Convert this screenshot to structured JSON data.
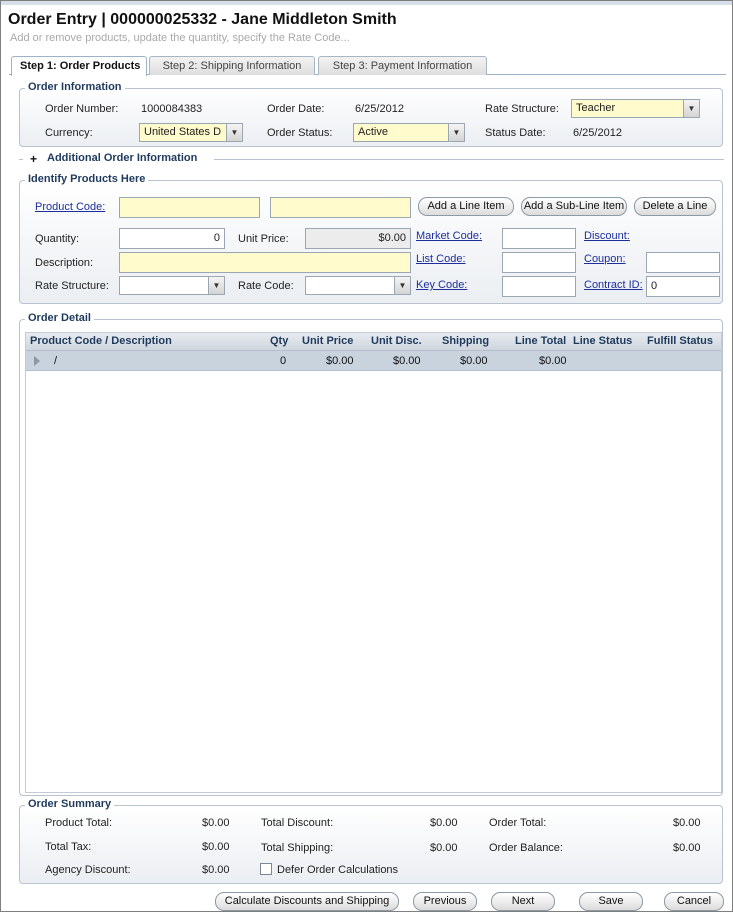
{
  "header": {
    "title": "Order Entry | 000000025332 - Jane Middleton Smith",
    "subtitle": "Add or remove products, update the quantity, specify the Rate Code..."
  },
  "tabs": [
    {
      "label": "Step 1: Order Products",
      "active": true
    },
    {
      "label": "Step 2: Shipping Information",
      "active": false
    },
    {
      "label": "Step 3: Payment Information",
      "active": false
    }
  ],
  "order_info": {
    "legend": "Order Information",
    "order_number_label": "Order Number:",
    "order_number": "1000084383",
    "order_date_label": "Order Date:",
    "order_date": "6/25/2012",
    "rate_structure_label": "Rate Structure:",
    "rate_structure": "Teacher",
    "currency_label": "Currency:",
    "currency": "United States D",
    "order_status_label": "Order Status:",
    "order_status": "Active",
    "status_date_label": "Status Date:",
    "status_date": "6/25/2012"
  },
  "additional": {
    "expander": "+",
    "label": "Additional Order Information"
  },
  "identify": {
    "legend": "Identify Products Here",
    "product_code_label": "Product Code:",
    "product_code": "",
    "product_code_2": "",
    "add_line_item": "Add a Line Item",
    "add_sub_line_item": "Add a Sub-Line Item",
    "delete_line": "Delete a Line",
    "quantity_label": "Quantity:",
    "quantity": "0",
    "unit_price_label": "Unit Price:",
    "unit_price": "$0.00",
    "market_code_label": "Market Code:",
    "market_code": "",
    "discount_label": "Discount:",
    "description_label": "Description:",
    "description": "",
    "list_code_label": "List Code:",
    "list_code": "",
    "coupon_label": "Coupon:",
    "coupon": "",
    "rate_structure_label": "Rate Structure:",
    "rate_structure": "",
    "rate_code_label": "Rate Code:",
    "rate_code": "",
    "key_code_label": "Key Code:",
    "key_code": "",
    "contract_id_label": "Contract ID:",
    "contract_id": "0"
  },
  "order_detail": {
    "legend": "Order Detail",
    "columns": [
      "Product Code / Description",
      "Qty",
      "Unit Price",
      "Unit Disc.",
      "Shipping",
      "Line Total",
      "Line Status",
      "Fulfill Status"
    ],
    "rows": [
      {
        "product": "/",
        "qty": "0",
        "unit_price": "$0.00",
        "unit_disc": "$0.00",
        "shipping": "$0.00",
        "line_total": "$0.00",
        "line_status": "",
        "fulfill_status": ""
      }
    ]
  },
  "summary": {
    "legend": "Order Summary",
    "product_total_label": "Product Total:",
    "product_total": "$0.00",
    "total_discount_label": "Total Discount:",
    "total_discount": "$0.00",
    "order_total_label": "Order Total:",
    "order_total": "$0.00",
    "total_tax_label": "Total Tax:",
    "total_tax": "$0.00",
    "total_shipping_label": "Total Shipping:",
    "total_shipping": "$0.00",
    "order_balance_label": "Order Balance:",
    "order_balance": "$0.00",
    "agency_discount_label": "Agency Discount:",
    "agency_discount": "$0.00",
    "defer_label": "Defer Order Calculations"
  },
  "footer": {
    "calculate": "Calculate Discounts and Shipping",
    "previous": "Previous",
    "next": "Next",
    "save": "Save",
    "cancel": "Cancel"
  }
}
